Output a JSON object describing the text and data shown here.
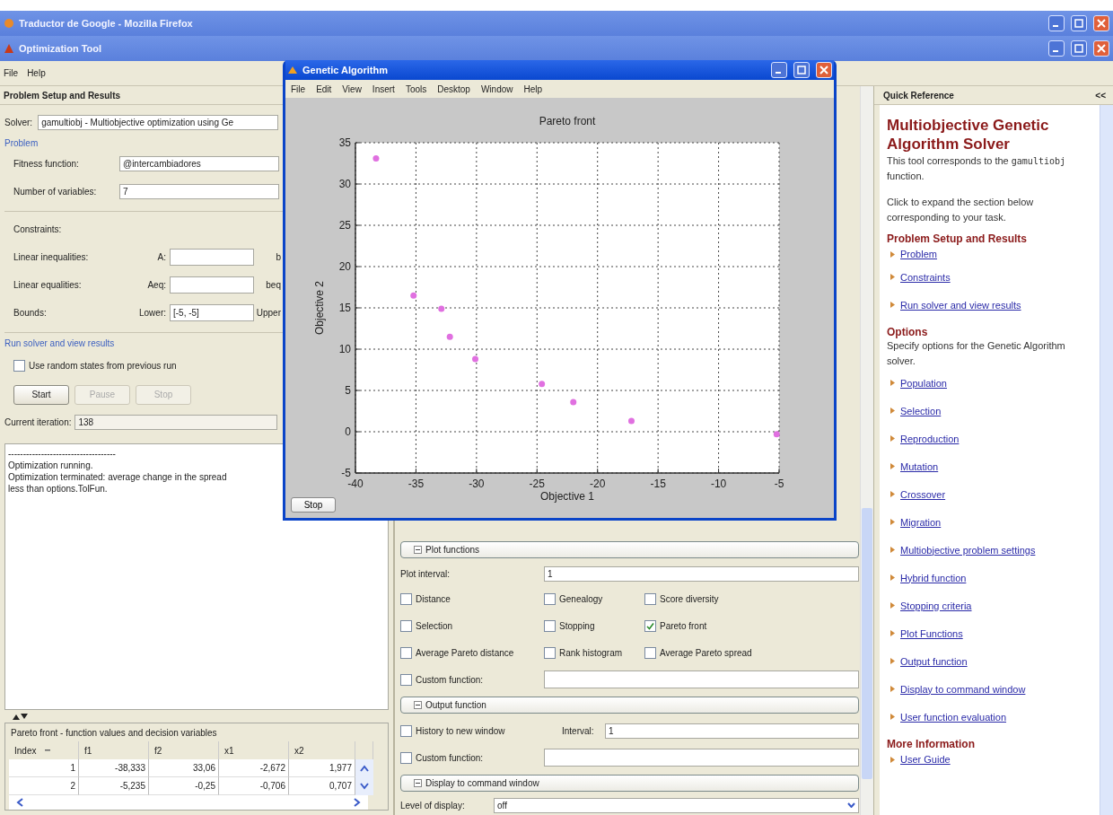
{
  "browser_window": {
    "title": "Traductor de Google - Mozilla Firefox"
  },
  "app_window": {
    "title": "Optimization Tool"
  },
  "menu": [
    "File",
    "Help"
  ],
  "left_panel": {
    "title": "Problem Setup and Results",
    "solver": {
      "label": "Solver:",
      "value": "gamultiobj - Multiobjective optimization using Ge"
    },
    "problem_heading": "Problem",
    "fields": [
      {
        "label": "Fitness function:",
        "value": "@intercambiadores"
      },
      {
        "label": "Number of variables:",
        "value": "7"
      }
    ],
    "constraints_heading": "Constraints:",
    "constraint_rows": [
      {
        "label": "Linear inequalities:",
        "field_label": "A:",
        "second_label": "b"
      },
      {
        "label": "Linear equalities:",
        "field_label": "Aeq:",
        "second_label": "beq"
      },
      {
        "label": "Bounds:",
        "field_label": "Lower:",
        "value": "[-5, -5]",
        "second_label": "Upper"
      }
    ],
    "run_heading": "Run solver and view results",
    "random_states": {
      "label": "Use random states from previous run",
      "checked": false
    },
    "buttons": [
      {
        "label": "Start",
        "disabled": false
      },
      {
        "label": "Pause",
        "disabled": true
      },
      {
        "label": "Stop",
        "disabled": true
      }
    ],
    "iteration": {
      "label": "Current iteration:",
      "value": "138"
    },
    "output_lines": [
      "------------------------------------",
      "Optimization running.",
      "Optimization terminated: average change in the spread",
      "less than options.TolFun."
    ],
    "results_table": {
      "title": "Pareto front - function values and decision variables",
      "columns": [
        "Index",
        "f1",
        "f2",
        "x1",
        "x2"
      ],
      "rows": [
        [
          "1",
          "-38,333",
          "33,06",
          "-2,672",
          "1,977"
        ],
        [
          "2",
          "-5,235",
          "-0,25",
          "-0,706",
          "0,707"
        ]
      ]
    }
  },
  "figure_window": {
    "title": "Genetic Algorithm",
    "menu": [
      "File",
      "Edit",
      "View",
      "Insert",
      "Tools",
      "Desktop",
      "Window",
      "Help"
    ],
    "stop_button": "Stop",
    "chart_data": {
      "type": "scatter",
      "title": "Pareto front",
      "xlabel": "Objective 1",
      "ylabel": "Objective 2",
      "x": [
        -38.3,
        -35.2,
        -32.9,
        -32.2,
        -30.1,
        -24.6,
        -22.0,
        -17.2,
        -5.2
      ],
      "series": [
        {
          "color": "#e070e0",
          "values": [
            33.1,
            16.5,
            14.9,
            11.5,
            8.8,
            5.8,
            3.6,
            1.3,
            -0.3
          ]
        }
      ],
      "grid": true,
      "xlim": [
        -40,
        -5
      ],
      "ylim": [
        -5,
        35
      ],
      "xticks": [
        -40,
        -35,
        -30,
        -25,
        -20,
        -15,
        -10,
        -5
      ],
      "yticks": [
        -5,
        0,
        5,
        10,
        15,
        20,
        25,
        30,
        35
      ]
    }
  },
  "options_panel": {
    "sections": [
      {
        "kind": "plot",
        "title": "Plot functions",
        "expanded": true,
        "interval": {
          "label": "Plot interval:",
          "value": "1"
        },
        "options": [
          {
            "label": "Distance",
            "checked": false
          },
          {
            "label": "Genealogy",
            "checked": false
          },
          {
            "label": "Score diversity",
            "checked": false
          },
          {
            "label": "Selection",
            "checked": false
          },
          {
            "label": "Stopping",
            "checked": false
          },
          {
            "label": "Pareto front",
            "checked": true
          },
          {
            "label": "Average Pareto distance",
            "checked": false
          },
          {
            "label": "Rank histogram",
            "checked": false
          },
          {
            "label": "Average Pareto spread",
            "checked": false
          }
        ],
        "custom": {
          "label": "Custom function:",
          "checked": false
        }
      },
      {
        "kind": "output",
        "title": "Output function",
        "expanded": true,
        "history": {
          "label": "History to new window",
          "checked": false
        },
        "interval": {
          "label": "Interval:",
          "value": "1"
        },
        "custom": {
          "label": "Custom function:",
          "checked": false
        }
      },
      {
        "kind": "display",
        "title": "Display to command window",
        "expanded": true,
        "level": {
          "label": "Level of display:",
          "value": "off"
        }
      }
    ]
  },
  "quick_reference": {
    "title": "Quick Reference",
    "collapse": "<<",
    "heading": "Multiobjective Genetic Algorithm Solver",
    "intro": {
      "before": "This tool corresponds to the",
      "code": "gamultiobj",
      "after": "function."
    },
    "hint": "Click to expand the section below corresponding to your task.",
    "sections": [
      {
        "heading": "Problem Setup and Results",
        "links": [
          "Problem",
          "Constraints",
          "Run solver and view results"
        ]
      },
      {
        "heading": "Options",
        "description": "Specify options for the Genetic Algorithm solver.",
        "links": [
          "Population",
          "Selection",
          "Reproduction",
          "Mutation",
          "Crossover",
          "Migration",
          "Multiobjective problem settings",
          "Hybrid function",
          "Stopping criteria",
          "Plot Functions",
          "Output function",
          "Display to command window",
          "User function evaluation"
        ]
      },
      {
        "heading": "More Information",
        "links": [
          "User Guide"
        ]
      }
    ]
  }
}
